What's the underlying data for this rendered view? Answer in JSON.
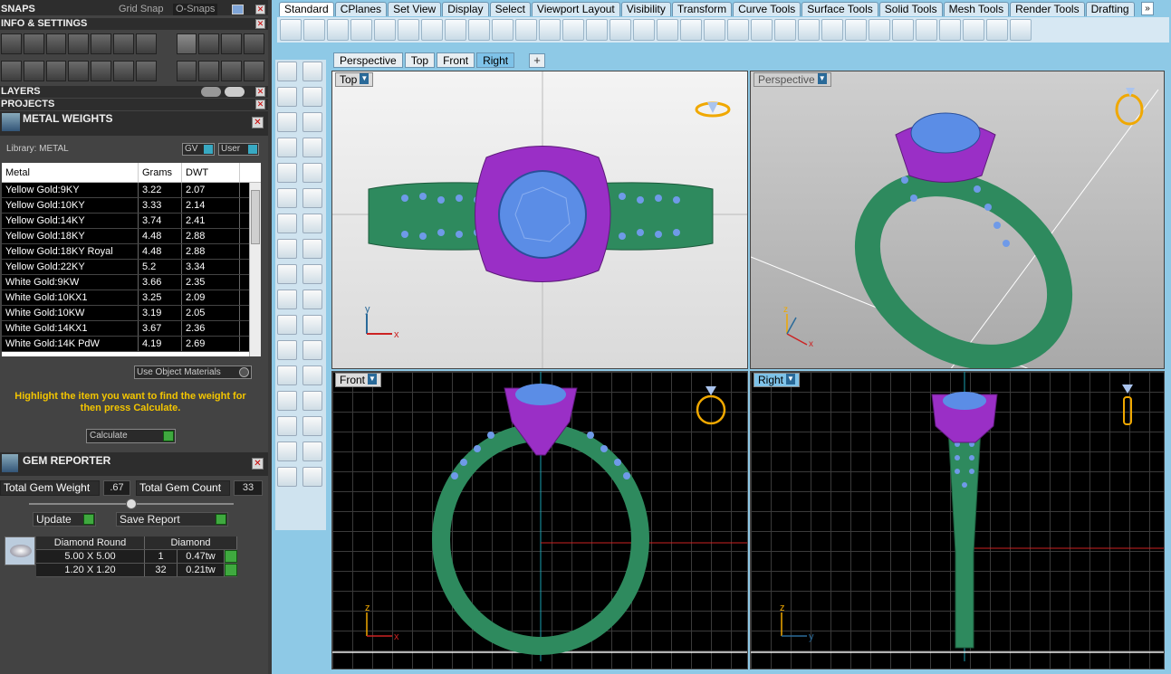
{
  "left": {
    "snaps": "SNAPS",
    "grid_snap": "Grid Snap",
    "o_snaps": "O-Snaps",
    "info_settings": "INFO & SETTINGS",
    "layers": "LAYERS",
    "projects": "PROJECTS",
    "metal_weights": {
      "title": "METAL WEIGHTS",
      "library": "Library: METAL",
      "gv": "GV",
      "user": "User",
      "headers": [
        "Metal",
        "Grams",
        "DWT"
      ],
      "rows": [
        [
          "Yellow Gold:9KY",
          "3.22",
          "2.07"
        ],
        [
          "Yellow Gold:10KY",
          "3.33",
          "2.14"
        ],
        [
          "Yellow Gold:14KY",
          "3.74",
          "2.41"
        ],
        [
          "Yellow Gold:18KY",
          "4.48",
          "2.88"
        ],
        [
          "Yellow Gold:18KY Royal",
          "4.48",
          "2.88"
        ],
        [
          "Yellow Gold:22KY",
          "5.2",
          "3.34"
        ],
        [
          "White Gold:9KW",
          "3.66",
          "2.35"
        ],
        [
          "White Gold:10KX1",
          "3.25",
          "2.09"
        ],
        [
          "White Gold:10KW",
          "3.19",
          "2.05"
        ],
        [
          "White Gold:14KX1",
          "3.67",
          "2.36"
        ],
        [
          "White Gold:14K PdW",
          "4.19",
          "2.69"
        ]
      ],
      "use_object_materials": "Use Object Materials",
      "hint": "Highlight the item you want to find the weight for then press Calculate.",
      "calculate": "Calculate"
    },
    "gem_reporter": {
      "title": "GEM REPORTER",
      "total_weight_label": "Total Gem Weight",
      "total_weight": ".67",
      "total_count_label": "Total Gem Count",
      "total_count": "33",
      "update": "Update",
      "save_report": "Save Report",
      "header": [
        "Diamond Round",
        "Diamond"
      ],
      "rows": [
        [
          "5.00 X 5.00",
          "1",
          "0.47tw"
        ],
        [
          "1.20 X 1.20",
          "32",
          "0.21tw"
        ]
      ]
    }
  },
  "tabs": [
    "Standard",
    "CPlanes",
    "Set View",
    "Display",
    "Select",
    "Viewport Layout",
    "Visibility",
    "Transform",
    "Curve Tools",
    "Surface Tools",
    "Solid Tools",
    "Mesh Tools",
    "Render Tools",
    "Drafting"
  ],
  "view_tabs": [
    "Perspective",
    "Top",
    "Front",
    "Right"
  ],
  "viewports": {
    "top": "Top",
    "perspective": "Perspective",
    "front": "Front",
    "right": "Right"
  },
  "colors": {
    "metal_green": "#2e8a5e",
    "prong_purple": "#9a2fc6",
    "gem_blue": "#5b8de6",
    "accent_gold": "#f0a800"
  }
}
